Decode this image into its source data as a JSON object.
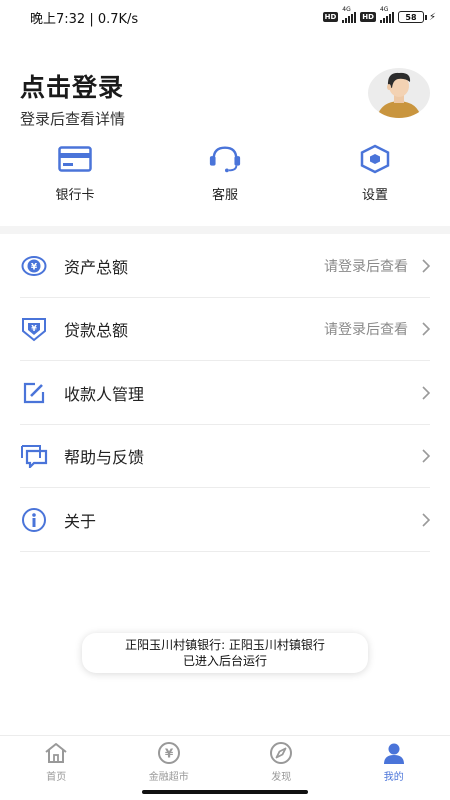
{
  "status_bar": {
    "time_speed": "晚上7:32 | 0.7K/s",
    "hd1": "HD",
    "net1": "4G",
    "hd2": "HD",
    "net2": "4G",
    "battery": "58",
    "battery_color": "#52c41a"
  },
  "header": {
    "title": "点击登录",
    "subtitle": "登录后查看详情",
    "avatar_icon": "user-avatar"
  },
  "quick": [
    {
      "label": "银行卡",
      "icon": "bank-card-icon"
    },
    {
      "label": "客服",
      "icon": "headset-icon"
    },
    {
      "label": "设置",
      "icon": "settings-hexagon-icon"
    }
  ],
  "menu": [
    {
      "label": "资产总额",
      "value": "请登录后查看",
      "icon": "yuan-coin-icon"
    },
    {
      "label": "贷款总额",
      "value": "请登录后查看",
      "icon": "yuan-shield-icon"
    },
    {
      "label": "收款人管理",
      "value": "",
      "icon": "edit-icon"
    },
    {
      "label": "帮助与反馈",
      "value": "",
      "icon": "chat-icon"
    },
    {
      "label": "关于",
      "value": "",
      "icon": "info-icon"
    }
  ],
  "toast": {
    "line1": "正阳玉川村镇银行: 正阳玉川村镇银行",
    "line2": "已进入后台运行"
  },
  "tabs": [
    {
      "label": "首页",
      "icon": "home-icon",
      "active": false
    },
    {
      "label": "金融超市",
      "icon": "yuan-circle-icon",
      "active": false
    },
    {
      "label": "发现",
      "icon": "compass-icon",
      "active": false
    },
    {
      "label": "我的",
      "icon": "user-icon",
      "active": true
    }
  ],
  "colors": {
    "accent": "#4a74d9",
    "inactive": "#999999"
  }
}
